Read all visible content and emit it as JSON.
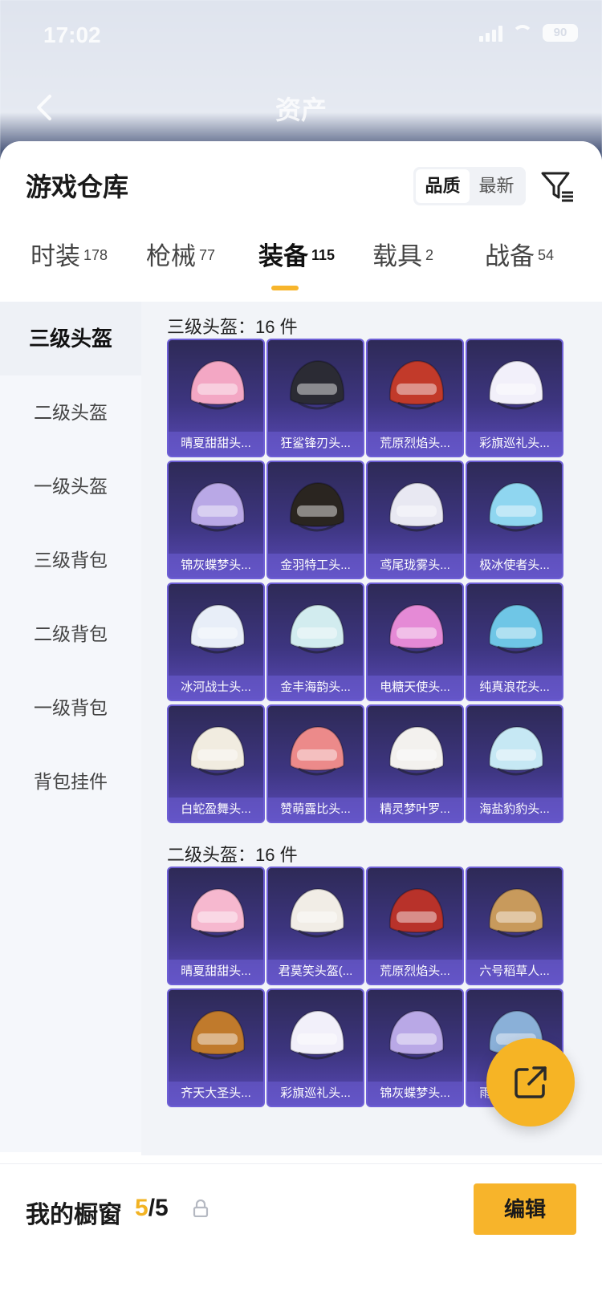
{
  "status_bar": {
    "time": "17:02",
    "battery": "90"
  },
  "nav": {
    "title": "资产"
  },
  "warehouse": {
    "title": "游戏仓库",
    "sort_options": [
      "品质",
      "最新"
    ],
    "active_sort": "品质"
  },
  "tabs": [
    {
      "label": "时装",
      "count": "178"
    },
    {
      "label": "枪械",
      "count": "77"
    },
    {
      "label": "装备",
      "count": "115",
      "active": true
    },
    {
      "label": "载具",
      "count": "2"
    },
    {
      "label": "战备",
      "count": "54"
    }
  ],
  "sidebar": [
    {
      "label": "三级头盔",
      "active": true
    },
    {
      "label": "二级头盔"
    },
    {
      "label": "一级头盔"
    },
    {
      "label": "三级背包"
    },
    {
      "label": "二级背包"
    },
    {
      "label": "一级背包"
    },
    {
      "label": "背包挂件"
    }
  ],
  "sections": [
    {
      "title": "三级头盔：16 件",
      "items": [
        {
          "name": "晴夏甜甜头...",
          "color": "#f3a7c4"
        },
        {
          "name": "狂鲨锋刃头...",
          "color": "#2b2b34"
        },
        {
          "name": "荒原烈焰头...",
          "color": "#c23a2a"
        },
        {
          "name": "彩旗巡礼头...",
          "color": "#f2f0fa"
        },
        {
          "name": "锦灰蝶梦头...",
          "color": "#b9a8e6"
        },
        {
          "name": "金羽特工头...",
          "color": "#2a2520"
        },
        {
          "name": "鸢尾珑雾头...",
          "color": "#e8e8f2"
        },
        {
          "name": "极冰使者头...",
          "color": "#8fd6f0"
        },
        {
          "name": "冰河战士头...",
          "color": "#e8eef8"
        },
        {
          "name": "金丰海韵头...",
          "color": "#d2ecef"
        },
        {
          "name": "电糖天使头...",
          "color": "#e58ad6"
        },
        {
          "name": "纯真浪花头...",
          "color": "#6fc6e6"
        },
        {
          "name": "白蛇盈舞头...",
          "color": "#f1ece0"
        },
        {
          "name": "赞萌露比头...",
          "color": "#ec8a8a"
        },
        {
          "name": "精灵梦叶罗...",
          "color": "#f3f1ee"
        },
        {
          "name": "海盐豹豹头...",
          "color": "#c6e8f4"
        }
      ]
    },
    {
      "title": "二级头盔：16 件",
      "items": [
        {
          "name": "晴夏甜甜头...",
          "color": "#f6b8cf"
        },
        {
          "name": "君莫笑头盔(...",
          "color": "#f1ede6"
        },
        {
          "name": "荒原烈焰头...",
          "color": "#b8322a"
        },
        {
          "name": "六号稻草人...",
          "color": "#c89a5c"
        },
        {
          "name": "齐天大圣头...",
          "color": "#c07a2c"
        },
        {
          "name": "彩旗巡礼头...",
          "color": "#f2f0fa"
        },
        {
          "name": "锦灰蝶梦头...",
          "color": "#b9a8e6"
        },
        {
          "name": "雨过天青头...",
          "color": "#8ab0d8"
        }
      ]
    }
  ],
  "showcase": {
    "label": "我的橱窗",
    "current": "5",
    "total": "/5",
    "edit_label": "编辑"
  },
  "colors": {
    "accent": "#f7b42b",
    "card_top": "#2e2a57",
    "card_bottom": "#5a4ab8"
  }
}
